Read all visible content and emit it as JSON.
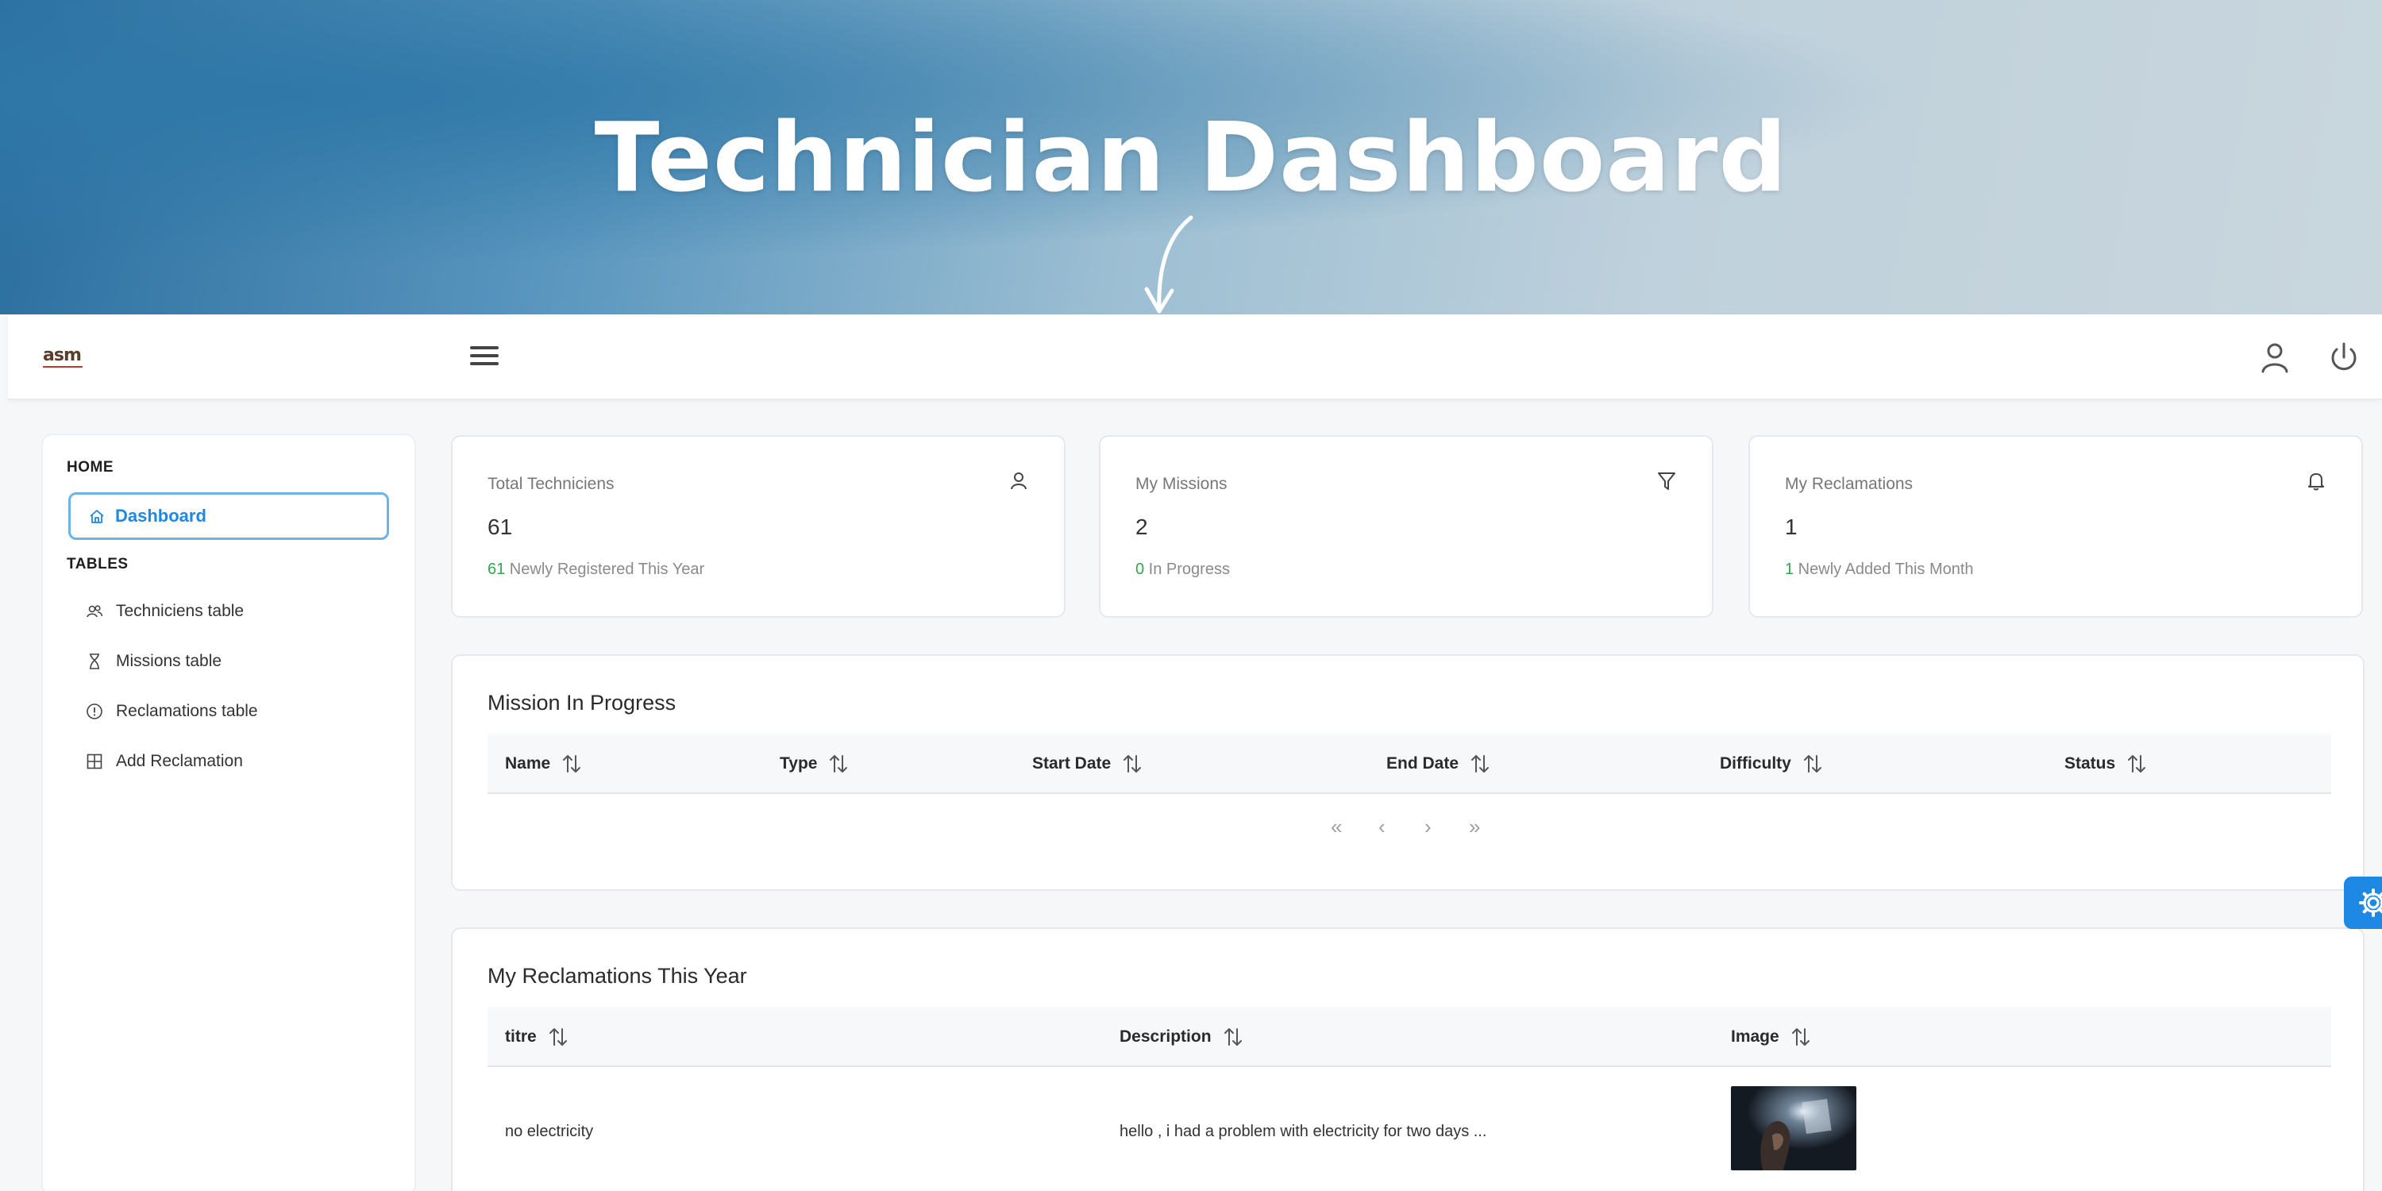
{
  "hero": {
    "title": "Technician Dashboard"
  },
  "topbar": {
    "logo_text": "asm"
  },
  "sidebar": {
    "home_section": "HOME",
    "dashboard_label": "Dashboard",
    "tables_section": "TABLES",
    "items": [
      {
        "label": "Techniciens table",
        "icon": "users-icon"
      },
      {
        "label": "Missions table",
        "icon": "hourglass-icon"
      },
      {
        "label": "Reclamations table",
        "icon": "alert-circle-icon"
      },
      {
        "label": "Add Reclamation",
        "icon": "grid-icon"
      }
    ]
  },
  "stats": [
    {
      "label": "Total Techniciens",
      "value": "61",
      "foot_num": "61",
      "foot_text": " Newly Registered This Year",
      "icon": "user-icon"
    },
    {
      "label": "My Missions",
      "value": "2",
      "foot_num": "0",
      "foot_text": " In Progress",
      "icon": "filter-icon"
    },
    {
      "label": "My Reclamations",
      "value": "1",
      "foot_num": "1",
      "foot_text": " Newly Added This Month",
      "icon": "bell-icon"
    }
  ],
  "missions": {
    "title": "Mission In Progress",
    "columns": [
      "Name",
      "Type",
      "Start Date",
      "End Date",
      "Difficulty",
      "Status"
    ],
    "pager": [
      "«",
      "‹",
      "›",
      "»"
    ]
  },
  "reclamations": {
    "title": "My Reclamations This Year",
    "columns": [
      "titre",
      "Description",
      "Image"
    ],
    "rows": [
      {
        "titre": "no electricity",
        "description": "hello , i had a problem with electricity for two days ..."
      }
    ]
  },
  "colors": {
    "accent": "#1e88e5",
    "positive": "#2ea84a",
    "active_border": "#6ab4e8"
  }
}
